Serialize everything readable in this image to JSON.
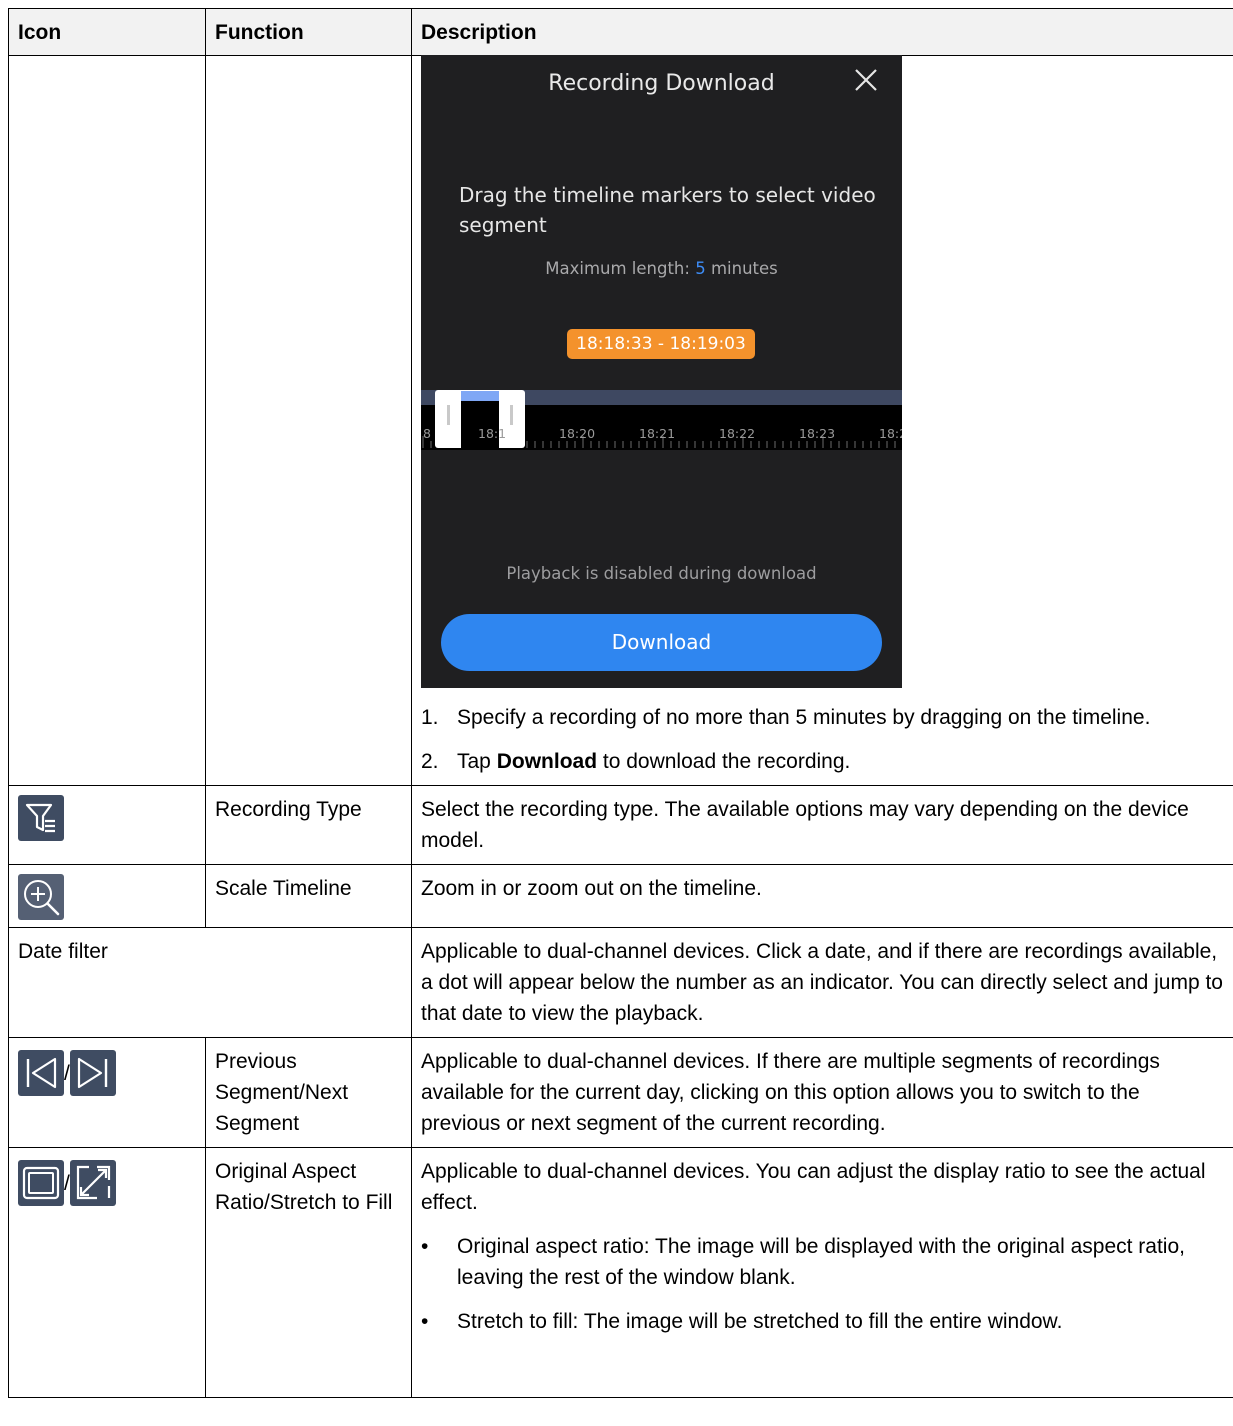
{
  "table": {
    "headers": [
      "Icon",
      "Function",
      "Description"
    ],
    "download_row": {
      "screenshot": {
        "title": "Recording Download",
        "instruction": "Drag the timeline markers to select video segment",
        "max_length_prefix": "Maximum length: ",
        "max_length_value": "5",
        "max_length_suffix": " minutes",
        "range": "18:18:33 - 18:19:03",
        "ticks": [
          "8",
          "18:1",
          "18:20",
          "18:21",
          "18:22",
          "18:23",
          "18:2"
        ],
        "note": "Playback is disabled during download",
        "button": "Download"
      },
      "steps": [
        {
          "num": "1.",
          "text": "Specify a recording of no more than 5 minutes by dragging on the timeline."
        },
        {
          "num": "2.",
          "pre": "Tap ",
          "bold": "Download",
          "post": " to download the recording."
        }
      ]
    },
    "recording_type": {
      "icon": "filter-list-icon",
      "function": "Recording Type",
      "description": "Select the recording type. The available options may vary depending on the device model."
    },
    "scale_timeline": {
      "icon": "zoom-in-icon",
      "function": "Scale Timeline",
      "description": "Zoom in or zoom out on the timeline."
    },
    "date_filter": {
      "label": "Date filter",
      "description": "Applicable to dual-channel devices. Click a date, and if there are recordings available, a dot will appear below the number as an indicator. You can directly select and jump to that date to view the playback."
    },
    "segment": {
      "icons": [
        "previous-segment-icon",
        "next-segment-icon"
      ],
      "separator": "/",
      "function": "Previous Segment/Next Segment",
      "description": "Applicable to dual-channel devices. If there are multiple segments of recordings available for the current day, clicking on this option allows you to switch to the previous or next segment of the current recording."
    },
    "aspect": {
      "icons": [
        "original-aspect-icon",
        "stretch-icon"
      ],
      "separator": "/",
      "function": "Original Aspect Ratio/Stretch to Fill",
      "description": "Applicable to dual-channel devices. You can adjust the display ratio to see the actual effect.",
      "bullets": [
        "Original aspect ratio: The image will be displayed with the original aspect ratio, leaving the rest of the window blank.",
        "Stretch to fill: The image will be stretched to fill the entire window."
      ],
      "bullet_mark": "•"
    }
  },
  "colors": {
    "header_bg": "#f2f2f2",
    "phone_bg": "#1f1f21",
    "range_badge": "#f4922c",
    "download_button": "#2f86f0",
    "icon_tile": "#3f4c62"
  }
}
